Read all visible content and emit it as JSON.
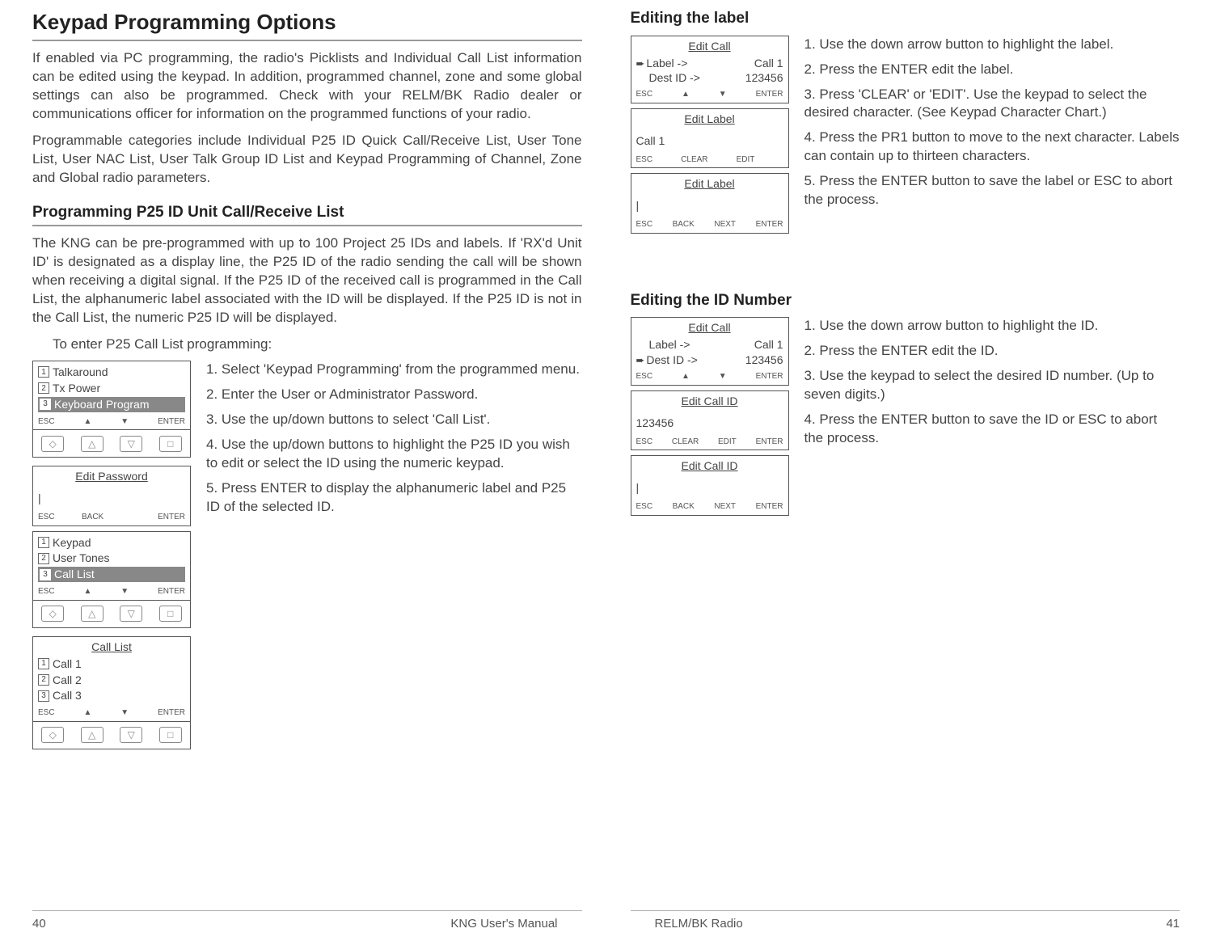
{
  "left": {
    "h1": "Keypad Programming Options",
    "p1": "If enabled via PC programming, the radio's Picklists and Individual Call List information can be edited using the keypad. In addition, programmed channel, zone and some global settings can also be programmed. Check with your RELM/BK Radio dealer or communications officer for information on the programmed functions of your radio.",
    "p2": "Programmable categories include Individual P25 ID Quick Call/Receive List, User Tone List, User NAC List, User Talk Group ID List and Keypad Programming of Channel, Zone and Global radio parameters.",
    "h2": "Programming P25 ID Unit Call/Receive  List",
    "p3": "The KNG can be pre-programmed with up to 100 Project 25 IDs and labels. If 'RX'd Unit ID' is designated as a display line, the P25 ID of the radio sending the call will be shown when receiving a digital signal. If the P25 ID of the received call is programmed in the Call List, the alphanumeric label associated with the ID will be displayed. If the P25 ID is not in the Call List, the numeric P25 ID will be displayed.",
    "intro": "To enter P25 Call List programming:",
    "steps": {
      "s1": "1.    Select 'Keypad Programming' from the programmed menu.",
      "s2": "2.    Enter the User or Administrator Password.",
      "s3": "3.    Use the up/down buttons to select 'Call List'.",
      "s4": "4.    Use the up/down buttons to highlight the P25 ID you wish to edit or select the ID using the numeric keypad.",
      "s5": "5.    Press ENTER to display  the alphanumeric label and P25 ID of the selected ID."
    },
    "screen1": {
      "l1": "Talkaround",
      "l2": "Tx Power",
      "l3": "Keyboard Program",
      "sk": [
        "ESC",
        "▲",
        "▼",
        "ENTER"
      ]
    },
    "screen2": {
      "title": "Edit Password",
      "body": "|",
      "sk": [
        "ESC",
        "BACK",
        "",
        "ENTER"
      ]
    },
    "screen3": {
      "l1": "Keypad",
      "l2": "User Tones",
      "l3": "Call List",
      "sk": [
        "ESC",
        "▲",
        "▼",
        "ENTER"
      ]
    },
    "screen4": {
      "title": "Call List",
      "l1": "Call 1",
      "l2": "Call 2",
      "l3": "Call 3",
      "sk": [
        "ESC",
        "▲",
        "▼",
        "ENTER"
      ]
    },
    "footer": {
      "page": "40",
      "center": "KNG User's Manual"
    }
  },
  "right": {
    "sec1": {
      "h3": "Editing the label",
      "screenA": {
        "title": "Edit Call",
        "row1l": "Label ->",
        "row1r": "Call 1",
        "row2l": "Dest ID ->",
        "row2r": "123456",
        "sk": [
          "ESC",
          "▲",
          "▼",
          "ENTER"
        ]
      },
      "screenB": {
        "title": "Edit Label",
        "body": "Call 1",
        "sk": [
          "ESC",
          "CLEAR",
          "EDIT",
          ""
        ]
      },
      "screenC": {
        "title": "Edit Label",
        "body": "|",
        "sk": [
          "ESC",
          "BACK",
          "NEXT",
          "ENTER"
        ]
      },
      "steps": {
        "s1": "1.       Use the down arrow button to highlight the label.",
        "s2": "2.       Press the ENTER edit the label.",
        "s3": "3.       Press 'CLEAR' or 'EDIT'. Use the keypad to select the desired character. (See Keypad Character Chart.)",
        "s4": "4.       Press the PR1 button to move to the next character. Labels can contain up to thirteen characters.",
        "s5": "5.       Press the ENTER button to save the label or ESC to abort the process."
      }
    },
    "sec2": {
      "h3": "Editing the ID Number",
      "screenA": {
        "title": "Edit Call",
        "row1l": "Label ->",
        "row1r": "Call 1",
        "row2l": "Dest ID ->",
        "row2r": "123456",
        "sk": [
          "ESC",
          "▲",
          "▼",
          "ENTER"
        ]
      },
      "screenB": {
        "title": "Edit Call ID",
        "body": "123456",
        "sk": [
          "ESC",
          "CLEAR",
          "EDIT",
          "ENTER"
        ]
      },
      "screenC": {
        "title": "Edit Call ID",
        "body": "|",
        "sk": [
          "ESC",
          "BACK",
          "NEXT",
          "ENTER"
        ]
      },
      "steps": {
        "s1": "1.       Use the down arrow button to highlight the ID.",
        "s2": "2.       Press the ENTER edit the ID.",
        "s3": "3.       Use the keypad to select the desired ID number. (Up to seven digits.)",
        "s4": "4.        Press the ENTER button to save the ID or ESC to abort the process."
      }
    },
    "footer": {
      "page": "41",
      "left": "RELM/BK Radio"
    }
  },
  "nums": {
    "n1": "1",
    "n2": "2",
    "n3": "3"
  },
  "glyph": {
    "diamond": "◇",
    "tri_up": "△",
    "tri_down": "▽",
    "square": "□",
    "arrow": "➨"
  }
}
